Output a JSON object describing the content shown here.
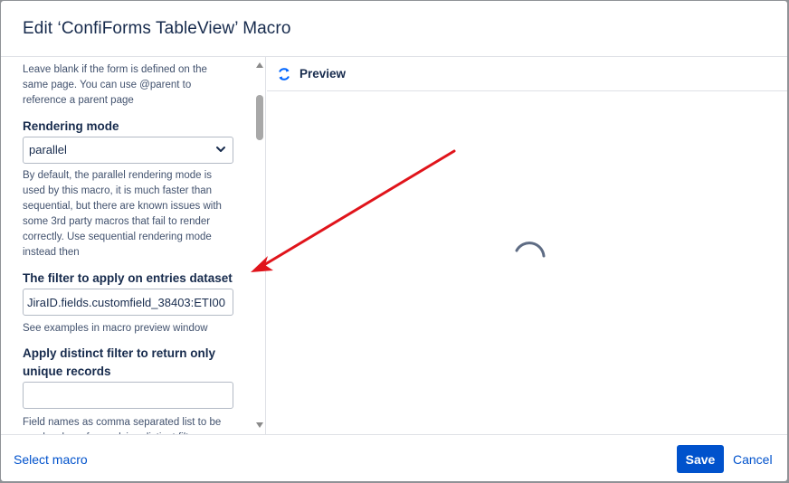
{
  "dialog": {
    "title": "Edit ‘ConfiForms TableView’ Macro"
  },
  "form": {
    "form_help": "Leave blank if the form is defined on the same page. You can use @parent to reference a parent page",
    "rendering_mode": {
      "label": "Rendering mode",
      "selected": "parallel",
      "help": "By default, the parallel rendering mode is used by this macro, it is much faster than sequential, but there are known issues with some 3rd party macros that fail to render correctly. Use sequential rendering mode instead then"
    },
    "filter": {
      "label": "The filter to apply on entries dataset",
      "value": "JiraID.fields.customfield_38403:ETI00",
      "help": "See examples in macro preview window"
    },
    "distinct": {
      "label": "Apply distinct filter to return only unique records",
      "value": "",
      "help": "Field names as comma separated list to be used as keys for applying distinct filter"
    }
  },
  "preview": {
    "label": "Preview",
    "icon": "refresh-icon",
    "loading": true
  },
  "footer": {
    "select_macro": "Select macro",
    "save": "Save",
    "cancel": "Cancel"
  },
  "colors": {
    "primary": "#0052cc",
    "annotation_arrow": "#e0141b"
  }
}
